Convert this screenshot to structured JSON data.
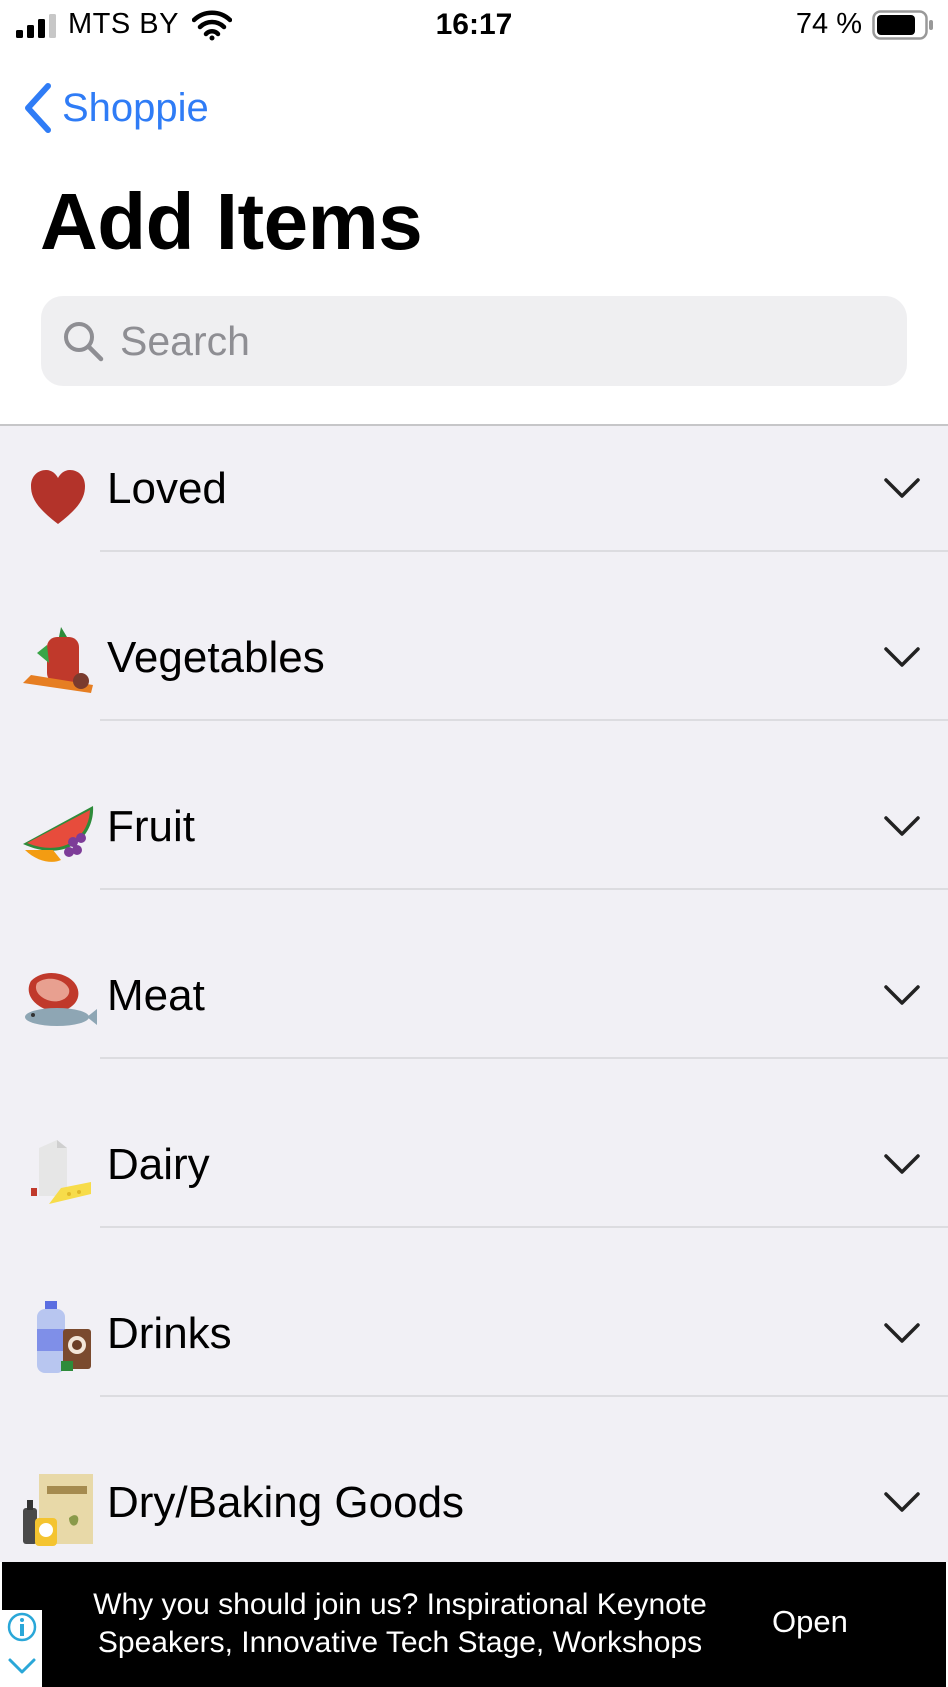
{
  "status_bar": {
    "carrier": "MTS BY",
    "time": "16:17",
    "battery": "74 %"
  },
  "nav": {
    "back_label": "Shoppie"
  },
  "page": {
    "title": "Add Items"
  },
  "search": {
    "placeholder": "Search"
  },
  "categories": [
    {
      "label": "Loved",
      "icon": "heart-icon"
    },
    {
      "label": "Vegetables",
      "icon": "vegetables-icon"
    },
    {
      "label": "Fruit",
      "icon": "fruit-icon"
    },
    {
      "label": "Meat",
      "icon": "meat-icon"
    },
    {
      "label": "Dairy",
      "icon": "dairy-icon"
    },
    {
      "label": "Drinks",
      "icon": "drinks-icon"
    },
    {
      "label": "Dry/Baking Goods",
      "icon": "dry-goods-icon"
    }
  ],
  "ad": {
    "line1": "Why you should join us? Inspirational Keynote",
    "line2": "Speakers, Innovative Tech Stage, Workshops",
    "open_label": "Open"
  },
  "colors": {
    "accent": "#2f7cf6",
    "list_background": "#f1f0f5",
    "search_background": "#efeff1",
    "ad_background": "#000000"
  }
}
